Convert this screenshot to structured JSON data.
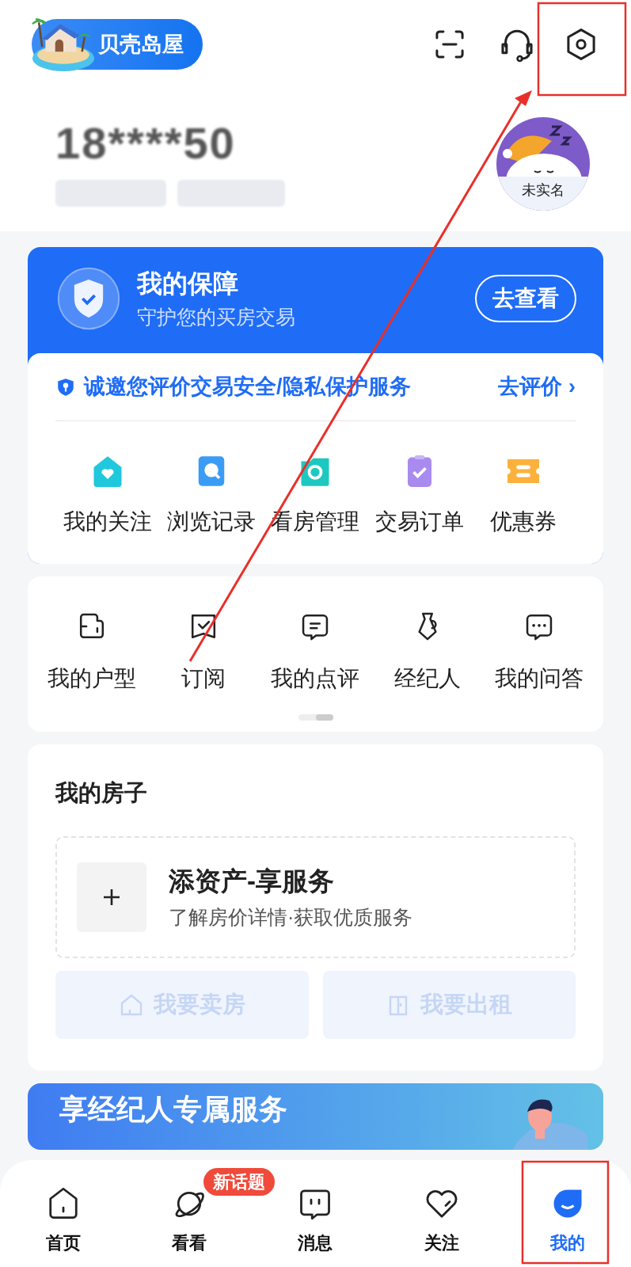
{
  "header": {
    "logo_text": "贝壳岛屋"
  },
  "profile": {
    "phone": "18****50",
    "avatar_label": "未实名"
  },
  "guarantee": {
    "title": "我的保障",
    "subtitle": "守护您的买房交易",
    "button": "去查看",
    "invite": "诚邀您评价交易安全/隐私保护服务",
    "invite_link": "去评价",
    "link_arrow": "›"
  },
  "quick_links": [
    "我的关注",
    "浏览记录",
    "看房管理",
    "交易订单",
    "优惠券"
  ],
  "tools": [
    "我的户型",
    "订阅",
    "我的点评",
    "经纪人",
    "我的问答"
  ],
  "my_house": {
    "title": "我的房子",
    "add_title": "添资产-享服务",
    "add_subtitle": "了解房价详情·获取优质服务",
    "buttons": [
      {
        "label": "我要卖房",
        "disabled": true
      },
      {
        "label": "我要出租",
        "disabled": true
      }
    ]
  },
  "banner": {
    "title": "享经纪人专属服务"
  },
  "tabs": [
    {
      "label": "首页",
      "selected": false
    },
    {
      "label": "看看",
      "selected": false,
      "badge": "新话题"
    },
    {
      "label": "消息",
      "selected": false
    },
    {
      "label": "关注",
      "selected": false
    },
    {
      "label": "我的",
      "selected": true
    }
  ]
}
